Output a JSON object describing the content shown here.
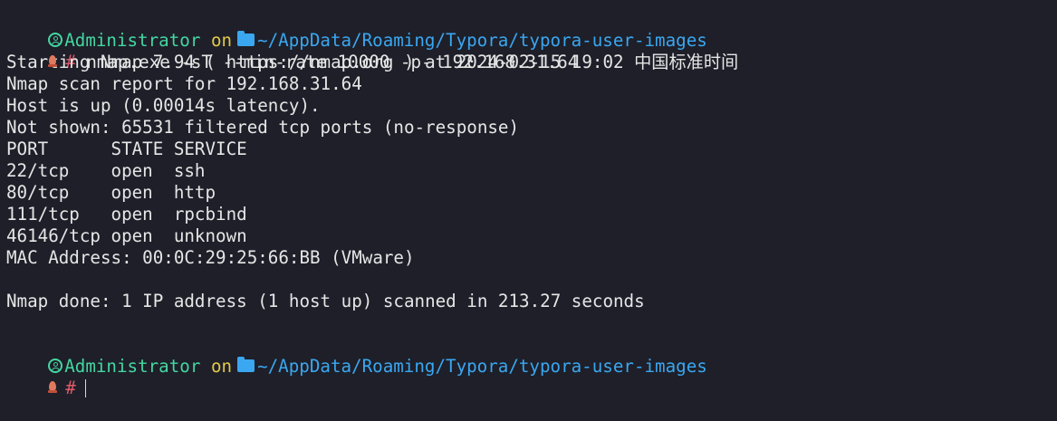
{
  "prompt": {
    "user": "Administrator",
    "on": "on",
    "path": "~/AppData/Roaming/Typora/typora-user-images",
    "symbol": "#"
  },
  "command": "nmap.exe -sT --min-rate 10000 -p- 192.168.31.64",
  "output": {
    "starting": "Starting Nmap 7.94 ( https://nmap.org ) at 2024-02-15 19:02 中国标准时间",
    "report": "Nmap scan report for 192.168.31.64",
    "host_up": "Host is up (0.00014s latency).",
    "not_shown": "Not shown: 65531 filtered tcp ports (no-response)",
    "table_header": "PORT      STATE SERVICE",
    "ports": [
      "22/tcp    open  ssh",
      "80/tcp    open  http",
      "111/tcp   open  rpcbind",
      "46146/tcp open  unknown"
    ],
    "mac": "MAC Address: 00:0C:29:25:66:BB (VMware)",
    "done": "Nmap done: 1 IP address (1 host up) scanned in 213.27 seconds"
  },
  "icons": {
    "user": "user-circle-icon",
    "folder": "folder-icon",
    "shell": "flame-icon"
  },
  "colors": {
    "background": "#1e1f29",
    "user": "#44d6a0",
    "on": "#e2c94a",
    "path": "#3aa7f0",
    "hash": "#e05a6a",
    "text": "#e6e6e6"
  }
}
